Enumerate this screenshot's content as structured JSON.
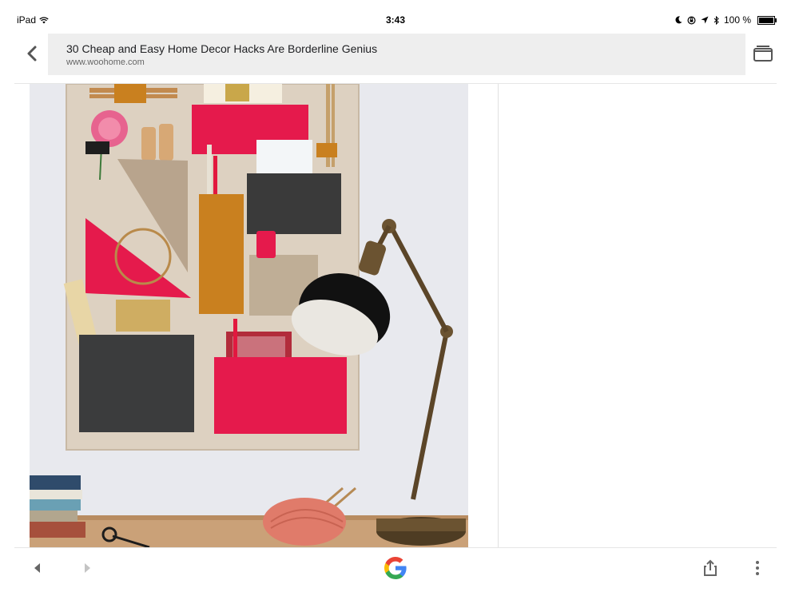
{
  "status_bar": {
    "device": "iPad",
    "time": "3:43",
    "battery_percent": "100 %",
    "icons": [
      "wifi-icon",
      "moon-icon",
      "rotation-lock-icon",
      "location-icon",
      "bluetooth-icon",
      "battery-icon"
    ]
  },
  "header": {
    "page_title": "30 Cheap and Easy Home Decor Hacks Are Borderline Genius",
    "domain": "www.woohome.com",
    "icons": [
      "back-chevron-icon",
      "tabs-icon"
    ]
  },
  "content": {
    "image_subject": "wall-hanging-organizer-and-desk-lamp"
  },
  "bottom_bar": {
    "icons": [
      "nav-back-icon",
      "nav-forward-icon",
      "google-logo",
      "share-icon",
      "more-vert-icon"
    ],
    "colors": {
      "google_blue": "#4285F4",
      "google_red": "#EA4335",
      "google_yellow": "#FBBC05",
      "google_green": "#34A853"
    }
  }
}
